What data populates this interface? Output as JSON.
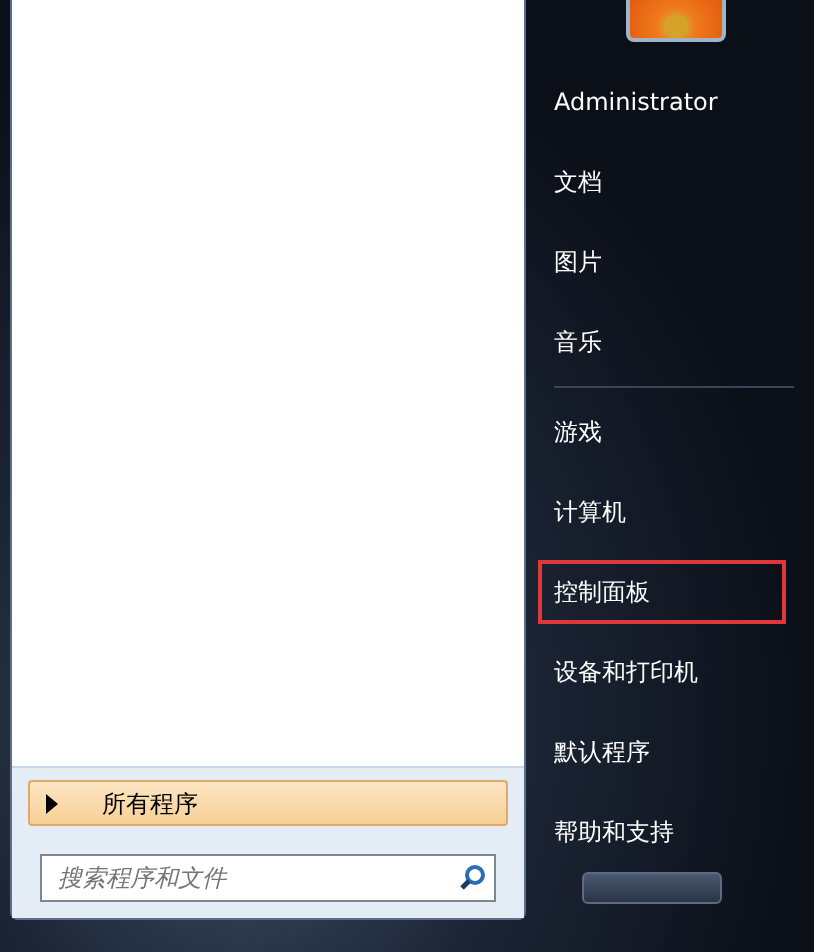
{
  "left_panel": {
    "all_programs": {
      "label": "所有程序",
      "selected": true
    },
    "search": {
      "placeholder": "搜索程序和文件"
    }
  },
  "right_panel": {
    "user_name": "Administrator",
    "groups": [
      [
        {
          "label": "文档",
          "highlighted": false
        },
        {
          "label": "图片",
          "highlighted": false
        },
        {
          "label": "音乐",
          "highlighted": false
        }
      ],
      [
        {
          "label": "游戏",
          "highlighted": false
        },
        {
          "label": "计算机",
          "highlighted": false
        },
        {
          "label": "控制面板",
          "highlighted": true
        },
        {
          "label": "设备和打印机",
          "highlighted": false
        },
        {
          "label": "默认程序",
          "highlighted": false
        },
        {
          "label": "帮助和支持",
          "highlighted": false
        }
      ]
    ]
  }
}
